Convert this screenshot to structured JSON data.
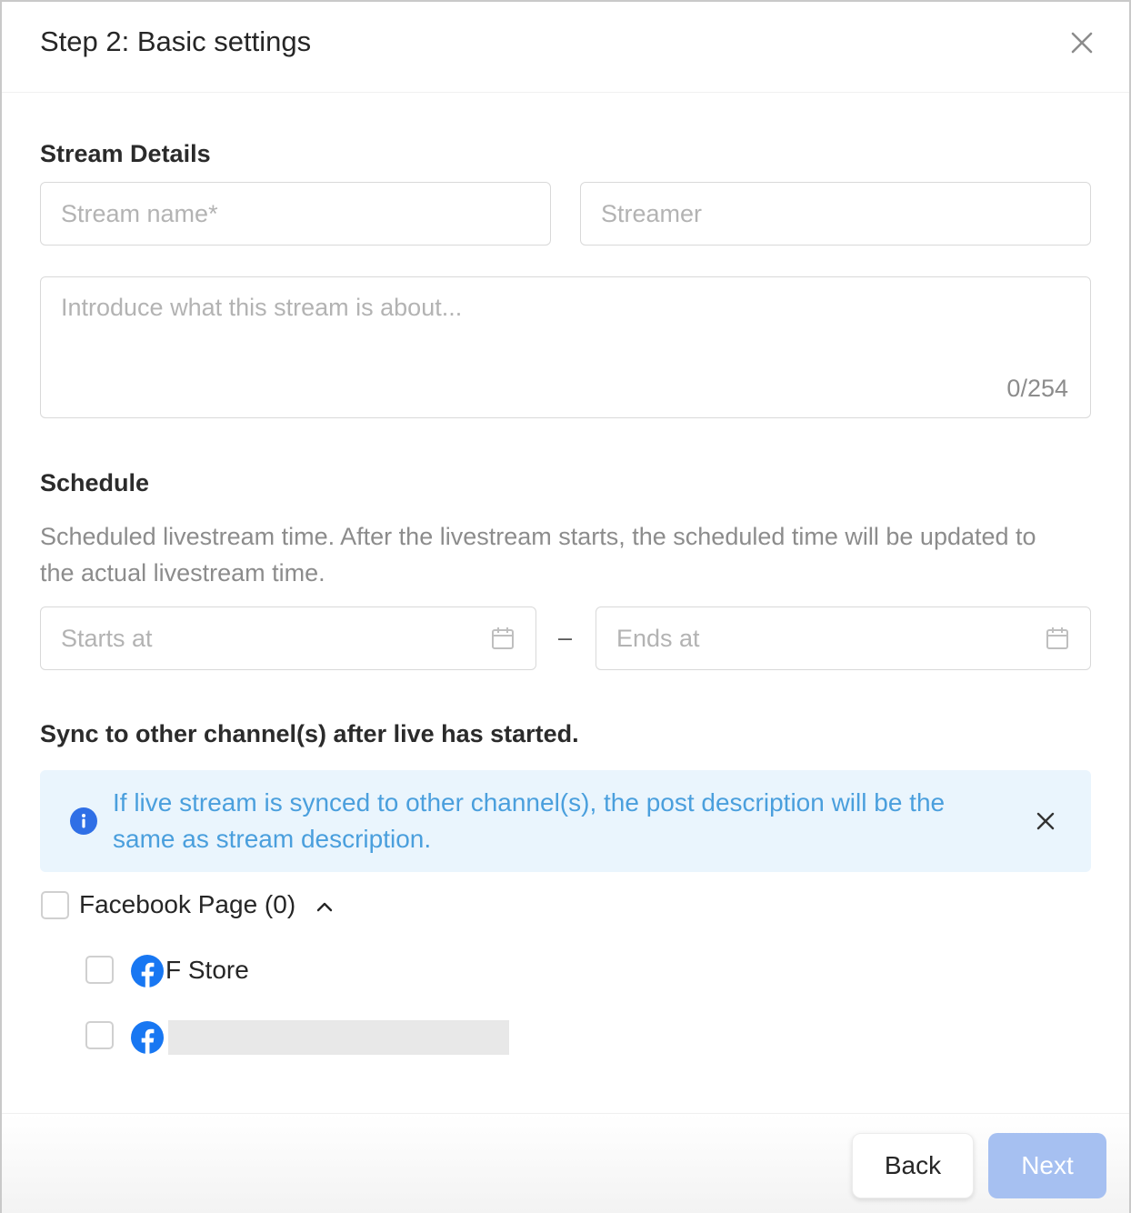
{
  "dialog": {
    "title": "Step 2: Basic settings"
  },
  "stream_details": {
    "heading": "Stream Details",
    "name_placeholder": "Stream name*",
    "streamer_placeholder": "Streamer",
    "description_placeholder": "Introduce what this stream is about...",
    "description_counter": "0/254"
  },
  "schedule": {
    "heading": "Schedule",
    "description": "Scheduled livestream time. After the livestream starts, the scheduled time will be updated to the actual livestream time.",
    "start_placeholder": "Starts at",
    "end_placeholder": "Ends at",
    "separator": "–"
  },
  "sync": {
    "heading": "Sync to other channel(s) after live has started.",
    "alert_text": "If live stream is synced to other channel(s), the post description will be the same as stream description.",
    "group_label": "Facebook Page (0)",
    "pages": [
      {
        "name": "F Store",
        "icon": "facebook-icon"
      },
      {
        "name": "",
        "icon": "facebook-icon"
      }
    ]
  },
  "footer": {
    "back_label": "Back",
    "next_label": "Next"
  },
  "colors": {
    "accent": "#4a9fdd",
    "info_bg": "#eaf5fd",
    "next_disabled": "#a6c0f1",
    "facebook": "#1877f2"
  }
}
